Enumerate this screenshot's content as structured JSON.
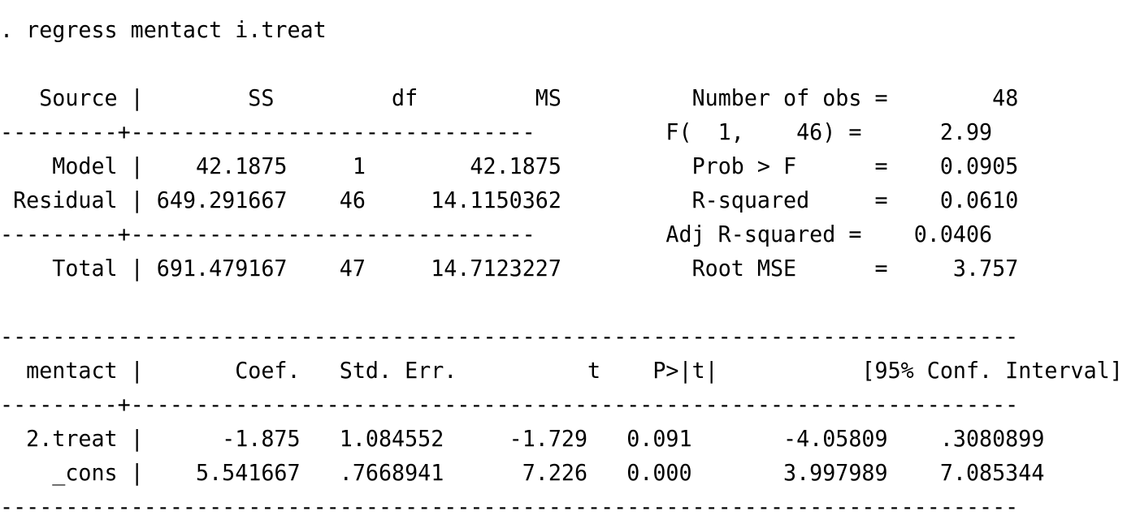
{
  "command": ". regress mentact i.treat",
  "anova": {
    "header": {
      "source": "Source",
      "ss": "SS",
      "df": "df",
      "ms": "MS"
    },
    "rows": [
      {
        "source": "Model",
        "ss": "42.1875",
        "df": "1",
        "ms": "42.1875"
      },
      {
        "source": "Residual",
        "ss": "649.291667",
        "df": "46",
        "ms": "14.1150362"
      }
    ],
    "total": {
      "source": "Total",
      "ss": "691.479167",
      "df": "47",
      "ms": "14.7123227"
    }
  },
  "stats": [
    {
      "label": "Number of obs",
      "value": "48"
    },
    {
      "label": "F(  1,    46)",
      "value": "2.99"
    },
    {
      "label": "Prob > F",
      "value": "0.0905"
    },
    {
      "label": "R-squared",
      "value": "0.0610"
    },
    {
      "label": "Adj R-squared",
      "value": "0.0406"
    },
    {
      "label": "Root MSE",
      "value": "3.757"
    }
  ],
  "coef_table": {
    "depvar": "mentact",
    "headers": {
      "coef": "Coef.",
      "se": "Std. Err.",
      "t": "t",
      "p": "P>|t|",
      "ci": "[95% Conf. Interval]"
    },
    "rows": [
      {
        "name": "2.treat",
        "coef": "-1.875",
        "se": "1.084552",
        "t": "-1.729",
        "p": "0.091",
        "ci_low": "-4.05809",
        "ci_high": ".3080899"
      },
      {
        "name": "_cons",
        "coef": "5.541667",
        "se": ".7668941",
        "t": "7.226",
        "p": "0.000",
        "ci_low": "3.997989",
        "ci_high": "7.085344"
      }
    ]
  }
}
